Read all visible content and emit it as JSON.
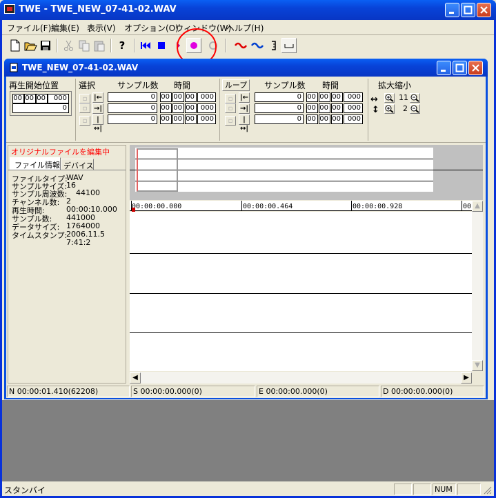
{
  "window": {
    "title": "TWE - TWE_NEW_07-41-02.WAV"
  },
  "menu": [
    "ファイル(F)",
    "編集(E)",
    "表示(V)",
    "オプション(O)",
    "ウィンドウ(W)",
    "ヘルプ(H)"
  ],
  "toolbar": {
    "buttons": [
      "new-file-icon",
      "open-folder-icon",
      "save-icon",
      "cut-icon",
      "copy-icon",
      "paste-icon",
      "help-icon",
      "skip-to-start-icon",
      "stop-icon",
      "play-icon",
      "record-icon",
      "record-disabled-icon",
      "wave-red-icon",
      "wave-blue-icon",
      "marker-icon",
      "ruler-icon"
    ],
    "help_glyph": "?"
  },
  "child": {
    "title": "TWE_NEW_07-41-02.WAV",
    "playback": {
      "label": "再生開始位置",
      "time": [
        "00",
        "00",
        "00",
        "000"
      ],
      "samples": "0"
    },
    "selection": {
      "label": "選択",
      "samples_header": "サンプル数",
      "time_header": "時間",
      "rows": [
        {
          "samples": "0",
          "time": [
            "00",
            "00",
            "00",
            "000"
          ]
        },
        {
          "samples": "0",
          "time": [
            "00",
            "00",
            "00",
            "000"
          ]
        },
        {
          "samples": "0",
          "time": [
            "00",
            "00",
            "00",
            "000"
          ]
        }
      ]
    },
    "loop": {
      "label": "ループ",
      "samples_header": "サンプル数",
      "time_header": "時間",
      "rows": [
        {
          "samples": "0",
          "time": [
            "00",
            "00",
            "00",
            "000"
          ]
        },
        {
          "samples": "0",
          "time": [
            "00",
            "00",
            "00",
            "000"
          ]
        },
        {
          "samples": "0",
          "time": [
            "00",
            "00",
            "00",
            "000"
          ]
        }
      ]
    },
    "zoom": {
      "label": "拡大縮小",
      "horizontal": "11",
      "vertical": "2"
    },
    "editing_notice": "オリジナルファイルを編集中",
    "tabs": [
      "ファイル情報",
      "デバイス"
    ],
    "file_info": [
      {
        "label": "ファイルタイプ:",
        "value": "WAV"
      },
      {
        "label": "サンプルサイズ:",
        "value": "16"
      },
      {
        "label": "サンプル周波数:",
        "value": "44100"
      },
      {
        "label": "チャンネル数:",
        "value": "2"
      },
      {
        "label": "再生時間:",
        "value": "00:00:10.000"
      },
      {
        "label": "サンプル数:",
        "value": "441000"
      },
      {
        "label": "データサイズ:",
        "value": "1764000"
      },
      {
        "label": "タイムスタンプ:",
        "value": "2006.11.5"
      },
      {
        "label": "",
        "value": "7:41:2"
      }
    ],
    "ruler": [
      "00:00:00.000",
      "00:00:00.464",
      "00:00:00.928",
      "00"
    ],
    "status": [
      "N 00:00:01.410(62208)",
      "S 00:00:00.000(0)",
      "E 00:00:00.000(0)",
      "D 00:00:00.000(0)"
    ]
  },
  "statusbar": {
    "text": "スタンバイ",
    "num": "NUM"
  },
  "colors": {
    "accent": "#0a50e0",
    "record": "#e000e0",
    "annotation": "#ff0000",
    "notice": "#ff0000"
  }
}
